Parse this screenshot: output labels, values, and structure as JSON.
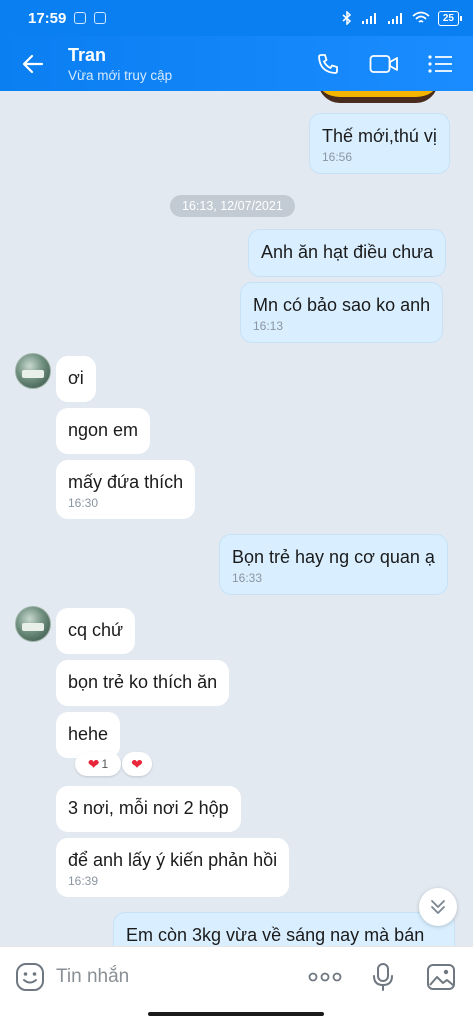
{
  "status_bar": {
    "time": "17:59",
    "battery": "25"
  },
  "header": {
    "contact_name": "Tran",
    "status": "Vừa mới truy cập",
    "icons": [
      "back-arrow-icon",
      "phone-icon",
      "video-call-icon",
      "menu-list-icon"
    ]
  },
  "messages": {
    "m1": {
      "text": "Thế mới,thú vị",
      "time": "16:56"
    },
    "date_divider": "16:13, 12/07/2021",
    "m2": {
      "text": "Anh ăn hạt điều chưa"
    },
    "m3": {
      "text": "Mn có bảo sao ko anh",
      "time": "16:13"
    },
    "m4": {
      "text": "ơi"
    },
    "m5": {
      "text": "ngon em"
    },
    "m6": {
      "text": "mấy đứa thích",
      "time": "16:30"
    },
    "m7": {
      "text": "Bọn trẻ hay ng cơ quan ạ",
      "time": "16:33"
    },
    "m8": {
      "text": "cq chứ"
    },
    "m9": {
      "text": "bọn trẻ ko thích ăn"
    },
    "m10": {
      "text": "hehe",
      "reaction_count": "1"
    },
    "m11": {
      "text": "3 nơi, mỗi nơi 2 hộp"
    },
    "m12": {
      "text": "để anh lấy ý kiến phản hồi",
      "time": "16:39"
    },
    "m13": {
      "text": "Em còn 3kg vừa về sáng nay mà bán"
    }
  },
  "input": {
    "placeholder": "Tin nhắn",
    "icons": [
      "emoji-icon",
      "more-options-icon",
      "microphone-icon",
      "image-icon"
    ]
  },
  "colors": {
    "accent": "#0a7ff2",
    "my_bubble": "#d9efff",
    "their_bubble": "#ffffff",
    "background": "#e2e9f1",
    "heart": "#e8273b"
  }
}
